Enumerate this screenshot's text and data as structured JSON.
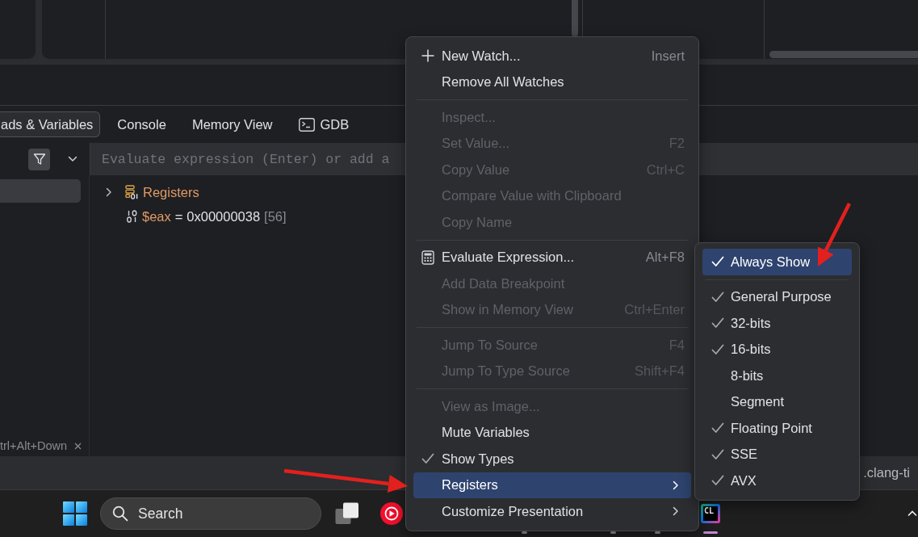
{
  "debugger_tabs": [
    {
      "label": "ads & Variables",
      "selected": true,
      "has_icon": false
    },
    {
      "label": "Console",
      "selected": false,
      "has_icon": false
    },
    {
      "label": "Memory View",
      "selected": false,
      "has_icon": false
    },
    {
      "label": "GDB",
      "selected": false,
      "has_icon": true
    }
  ],
  "frames_pane": {
    "filter_button": {
      "on": true
    },
    "rows": [
      {
        "selected": true
      }
    ],
    "hint": "trl+Alt+Down"
  },
  "evaluate_field": {
    "placeholder": "Evaluate expression (Enter) or add a"
  },
  "variables": [
    {
      "kind": "group",
      "name": "Registers",
      "expanded": false
    },
    {
      "kind": "register",
      "name": "$eax",
      "operator": "=",
      "value": "0x00000038",
      "decimal": "[56]"
    }
  ],
  "status_bar": {
    "text": ".clang-ti"
  },
  "taskbar": {
    "search": {
      "placeholder": "Search"
    },
    "apps": [
      {
        "kind": "taskview",
        "running": false,
        "active": false
      },
      {
        "kind": "music",
        "running": false,
        "active": false
      },
      {
        "kind": "covered"
      },
      {
        "kind": "covered"
      },
      {
        "kind": "covered",
        "running": true,
        "active": false
      },
      {
        "kind": "covered"
      },
      {
        "kind": "covered",
        "running": true,
        "active": false
      },
      {
        "kind": "covered",
        "running": true,
        "active": false
      },
      {
        "kind": "clion",
        "label": "CL",
        "running": true,
        "active": true
      }
    ]
  },
  "context_menu": {
    "items": [
      {
        "kind": "add",
        "label": "New Watch...",
        "shortcut": "Insert",
        "disabled": false,
        "selected": false
      },
      {
        "kind": "command",
        "label": "Remove All Watches",
        "disabled": false,
        "selected": false
      },
      {
        "kind": "separator"
      },
      {
        "kind": "command",
        "label": "Inspect...",
        "disabled": true,
        "selected": false
      },
      {
        "kind": "command",
        "label": "Set Value...",
        "shortcut": "F2",
        "disabled": true,
        "selected": false
      },
      {
        "kind": "command",
        "label": "Copy Value",
        "shortcut": "Ctrl+C",
        "disabled": true,
        "selected": false
      },
      {
        "kind": "command",
        "label": "Compare Value with Clipboard",
        "disabled": true,
        "selected": false
      },
      {
        "kind": "command",
        "label": "Copy Name",
        "disabled": true,
        "selected": false
      },
      {
        "kind": "separator"
      },
      {
        "kind": "evaluate",
        "label": "Evaluate Expression...",
        "shortcut": "Alt+F8",
        "disabled": false,
        "selected": false
      },
      {
        "kind": "command",
        "label": "Add Data Breakpoint",
        "disabled": true,
        "selected": false
      },
      {
        "kind": "command",
        "label": "Show in Memory View",
        "shortcut": "Ctrl+Enter",
        "disabled": true,
        "selected": false
      },
      {
        "kind": "separator"
      },
      {
        "kind": "command",
        "label": "Jump To Source",
        "shortcut": "F4",
        "disabled": true,
        "selected": false
      },
      {
        "kind": "command",
        "label": "Jump To Type Source",
        "shortcut": "Shift+F4",
        "disabled": true,
        "selected": false
      },
      {
        "kind": "separator"
      },
      {
        "kind": "command",
        "label": "View as Image...",
        "disabled": true,
        "selected": false
      },
      {
        "kind": "command",
        "label": "Mute Variables",
        "disabled": false,
        "selected": false
      },
      {
        "kind": "toggle",
        "label": "Show Types",
        "checked": true,
        "disabled": false,
        "selected": false
      },
      {
        "kind": "submenu",
        "label": "Registers",
        "disabled": false,
        "selected": true
      },
      {
        "kind": "submenu",
        "label": "Customize Presentation",
        "disabled": false,
        "selected": false
      }
    ]
  },
  "registers_submenu": {
    "items": [
      {
        "kind": "toggle",
        "label": "Always Show",
        "checked": true,
        "selected": true
      },
      {
        "kind": "separator"
      },
      {
        "kind": "toggle",
        "label": "General Purpose",
        "checked": true,
        "selected": false
      },
      {
        "kind": "toggle",
        "label": "32-bits",
        "checked": true,
        "selected": false
      },
      {
        "kind": "toggle",
        "label": "16-bits",
        "checked": true,
        "selected": false
      },
      {
        "kind": "toggle",
        "label": "8-bits",
        "checked": false,
        "selected": false
      },
      {
        "kind": "toggle",
        "label": "Segment",
        "checked": false,
        "selected": false
      },
      {
        "kind": "toggle",
        "label": "Floating Point",
        "checked": true,
        "selected": false
      },
      {
        "kind": "toggle",
        "label": "SSE",
        "checked": true,
        "selected": false
      },
      {
        "kind": "toggle",
        "label": "AVX",
        "checked": true,
        "selected": false
      }
    ]
  }
}
